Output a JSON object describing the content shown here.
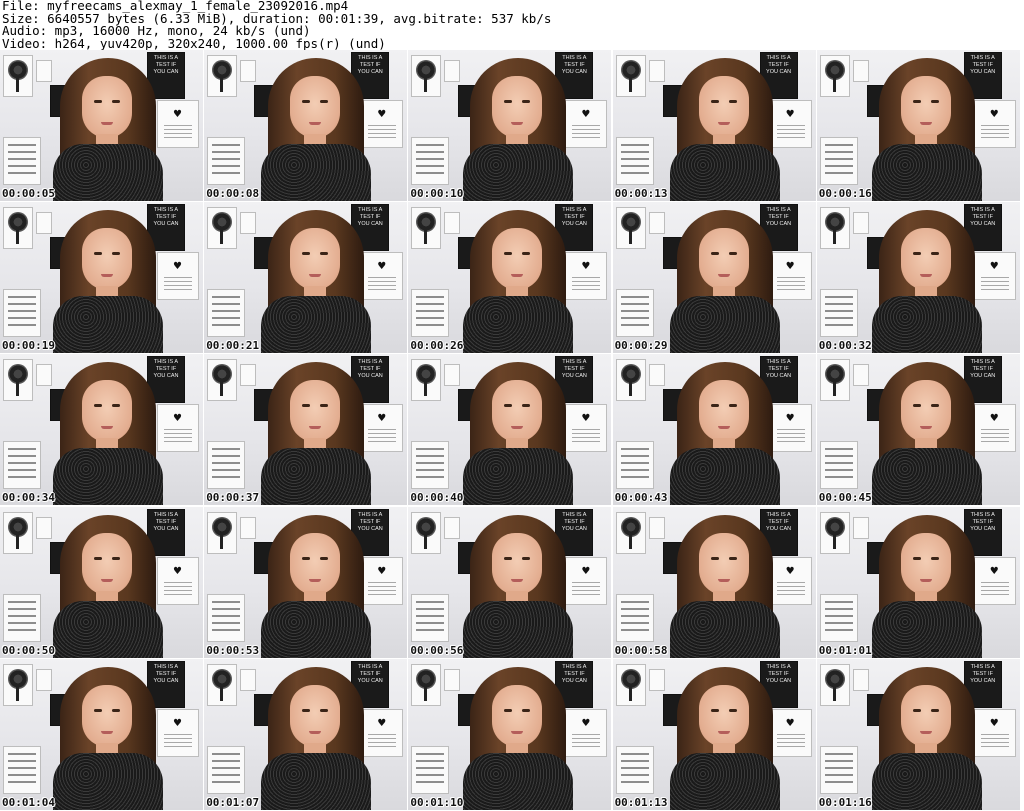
{
  "header": {
    "file_line": "File: myfreecams_alexmay_1_female_23092016.mp4",
    "size_line": "Size: 6640557 bytes (6.33 MiB), duration: 00:01:39, avg.bitrate: 537 kb/s",
    "audio_line": "Audio: mp3, 16000 Hz, mono, 24 kb/s (und)",
    "video_line": "Video: h264, yuv420p, 320x240, 1000.00 fps(r) (und)"
  },
  "poster_text": "THIS IS A TEST IF YOU CAN",
  "heart_symbol": "♥",
  "thumbnails": [
    {
      "timestamp": "00:00:05"
    },
    {
      "timestamp": "00:00:08"
    },
    {
      "timestamp": "00:00:10"
    },
    {
      "timestamp": "00:00:13"
    },
    {
      "timestamp": "00:00:16"
    },
    {
      "timestamp": "00:00:19"
    },
    {
      "timestamp": "00:00:21"
    },
    {
      "timestamp": "00:00:26"
    },
    {
      "timestamp": "00:00:29"
    },
    {
      "timestamp": "00:00:32"
    },
    {
      "timestamp": "00:00:34"
    },
    {
      "timestamp": "00:00:37"
    },
    {
      "timestamp": "00:00:40"
    },
    {
      "timestamp": "00:00:43"
    },
    {
      "timestamp": "00:00:45"
    },
    {
      "timestamp": "00:00:50"
    },
    {
      "timestamp": "00:00:53"
    },
    {
      "timestamp": "00:00:56"
    },
    {
      "timestamp": "00:00:58"
    },
    {
      "timestamp": "00:01:01"
    },
    {
      "timestamp": "00:01:04"
    },
    {
      "timestamp": "00:01:07"
    },
    {
      "timestamp": "00:01:10"
    },
    {
      "timestamp": "00:01:13"
    },
    {
      "timestamp": "00:01:16"
    }
  ]
}
